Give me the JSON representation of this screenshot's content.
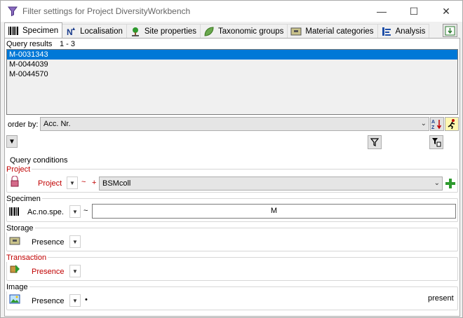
{
  "window": {
    "title": "Filter settings for Project DiversityWorkbench",
    "minimize": "—",
    "maximize": "☐",
    "close": "✕"
  },
  "tabs": [
    {
      "label": "Specimen",
      "icon": "barcode-icon",
      "active": true
    },
    {
      "label": "Localisation",
      "icon": "north-arrow-icon"
    },
    {
      "label": "Site properties",
      "icon": "tree-icon"
    },
    {
      "label": "Taxonomic groups",
      "icon": "leaf-icon"
    },
    {
      "label": "Material categories",
      "icon": "drawer-icon"
    },
    {
      "label": "Analysis",
      "icon": "analysis-icon"
    }
  ],
  "query_results": {
    "label": "Query results",
    "count": "1 - 3",
    "items": [
      "M-0031343",
      "M-0044039",
      "M-0044570"
    ],
    "selected_index": 0
  },
  "order_by": {
    "label": "order by:",
    "value": "Acc. Nr."
  },
  "query_conditions": {
    "label": "Query conditions",
    "project": {
      "label": "Project",
      "field": "Project",
      "operator": "~",
      "plus": "+",
      "value": "BSMcoll"
    },
    "specimen": {
      "label": "Specimen",
      "field": "Ac.no.spe.",
      "operator": "~",
      "value": "M"
    },
    "storage": {
      "label": "Storage",
      "field": "Presence"
    },
    "transaction": {
      "label": "Transaction",
      "field": "Presence"
    },
    "image": {
      "label": "Image",
      "field": "Presence",
      "operator": "•",
      "value": "present"
    }
  },
  "colors": {
    "selection": "#0078d7",
    "required_label": "#c00000",
    "add_green": "#2e9a2e"
  }
}
